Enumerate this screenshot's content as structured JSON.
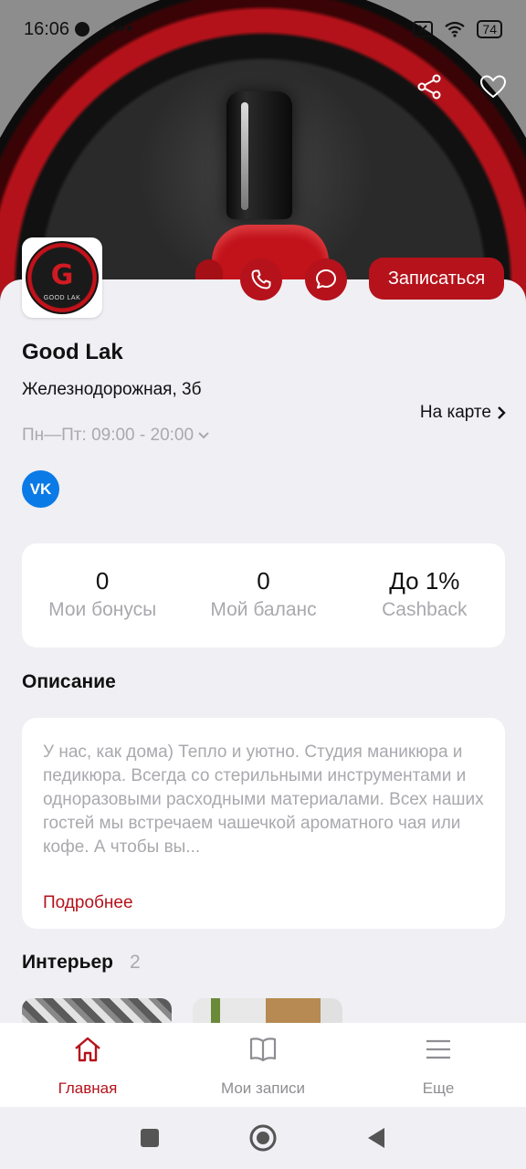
{
  "status_bar": {
    "time": "16:06",
    "dots": "•••",
    "battery": "74"
  },
  "hero": {
    "share_icon": "share-icon",
    "favorite_icon": "heart-icon"
  },
  "venue": {
    "logo_text": "GOOD LAK",
    "name": "Good Lak",
    "address": "Железнодорожная, 3б",
    "hours": "Пн—Пт: 09:00 - 20:00",
    "map_link": "На карте",
    "book_button": "Записаться",
    "social": "VK"
  },
  "stats": [
    {
      "value": "0",
      "label": "Мои бонусы"
    },
    {
      "value": "0",
      "label": "Мой баланс"
    },
    {
      "value": "До 1%",
      "label": "Cashback"
    }
  ],
  "description": {
    "title": "Описание",
    "text": "У нас, как дома) Тепло и уютно. Студия маникюра и педикюра. Всегда со стерильными инструментами и одноразовыми расходными материалами. Всех наших гостей мы встречаем чашечкой ароматного чая или кофе. А чтобы вы...",
    "more": "Подробнее"
  },
  "interior": {
    "title": "Интерьер",
    "count": "2"
  },
  "tabbar": [
    {
      "label": "Главная",
      "icon": "home-icon",
      "active": true
    },
    {
      "label": "Мои записи",
      "icon": "book-icon",
      "active": false
    },
    {
      "label": "Еще",
      "icon": "menu-icon",
      "active": false
    }
  ],
  "colors": {
    "accent": "#b5121b",
    "muted": "#a9a9ae",
    "background": "#efeff4"
  }
}
